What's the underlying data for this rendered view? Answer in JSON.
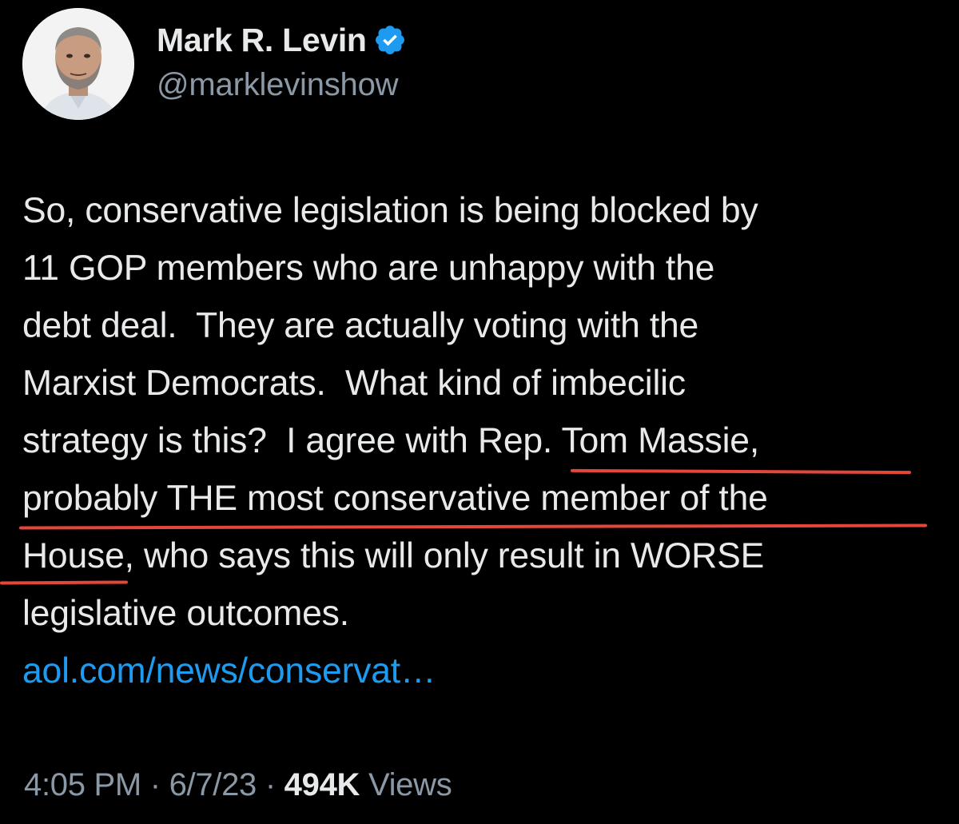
{
  "author": {
    "display_name": "Mark R. Levin",
    "handle": "@marklevinshow",
    "verified": true,
    "avatar_icon": "profile-photo",
    "badge_icon": "verified-badge-icon",
    "badge_color": "#1d9bf0"
  },
  "tweet": {
    "lines": [
      "So, conservative legislation is being blocked by",
      "11 GOP members who are unhappy with the",
      "debt deal.  They are actually voting with the",
      "Marxist Democrats.  What kind of imbecilic",
      "strategy is this?  I agree with Rep. Tom Massie,",
      "probably THE most conservative member of the",
      "House, who says this will only result in WORSE",
      "legislative outcomes."
    ],
    "link_text": "aol.com/news/conservat…",
    "link_color": "#1d9bf0",
    "annotation_color": "#e2473a"
  },
  "meta": {
    "time": "4:05 PM",
    "separator": "·",
    "date": "6/7/23",
    "views_count": "494K",
    "views_label": "Views"
  }
}
